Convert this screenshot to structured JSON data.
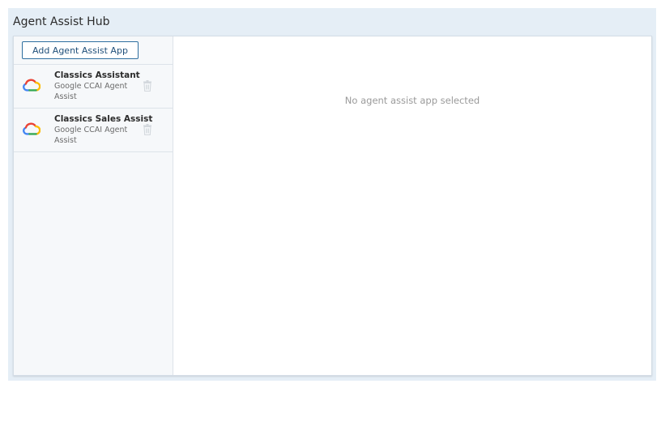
{
  "header": {
    "title": "Agent Assist Hub"
  },
  "sidebar": {
    "add_button_label": "Add Agent Assist App",
    "items": [
      {
        "name": "Classics Assistant",
        "type": "Google CCAI Agent Assist",
        "icon": "google-cloud-icon"
      },
      {
        "name": "Classics Sales Assist",
        "type": "Google CCAI Agent Assist",
        "icon": "google-cloud-icon"
      }
    ]
  },
  "content": {
    "empty_message": "No agent assist app selected"
  },
  "colors": {
    "hub_background": "#e5eef6",
    "button_border": "#2f6f9f",
    "google_blue": "#4285F4",
    "google_red": "#EA4335",
    "google_yellow": "#FBBC05",
    "google_green": "#34A853"
  }
}
